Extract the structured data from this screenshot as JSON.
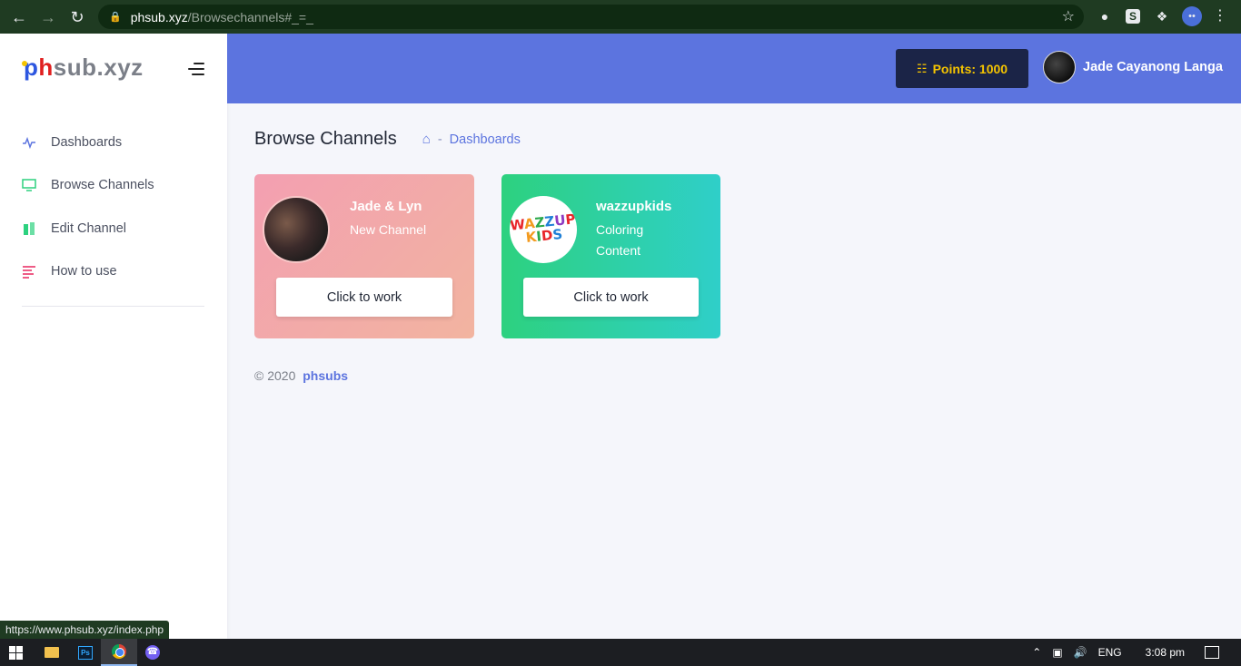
{
  "browser": {
    "url_host": "phsub.xyz",
    "url_path": "/Browsechannels#_=_",
    "status_url": "https://www.phsub.xyz/index.php"
  },
  "logo": {
    "p": "p",
    "h": "h",
    "rest": "sub.xyz"
  },
  "sidebar": {
    "items": [
      {
        "label": "Dashboards",
        "icon": "activity-icon",
        "color": "#5c74df"
      },
      {
        "label": "Browse Channels",
        "icon": "monitor-icon",
        "color": "#2dd17f"
      },
      {
        "label": "Edit Channel",
        "icon": "columns-icon",
        "color": "#2dd17f"
      },
      {
        "label": "How to use",
        "icon": "align-left-icon",
        "color": "#e8265e"
      }
    ]
  },
  "header": {
    "points_label": "Points: 1000",
    "user_name": "Jade Cayanong Langa",
    "bg_color": "#5c74df"
  },
  "page": {
    "title": "Browse Channels",
    "breadcrumb_sep": "-",
    "breadcrumb_item": "Dashboards"
  },
  "channels": [
    {
      "name": "Jade & Lyn",
      "subtitle": "New Channel",
      "button": "Click to work"
    },
    {
      "name": "wazzupkids",
      "subtitle": "Coloring Content",
      "button": "Click to work"
    }
  ],
  "footer": {
    "copyright": "© 2020",
    "brand": "phsubs"
  },
  "taskbar": {
    "lang": "ENG",
    "time": "3:08 pm"
  }
}
